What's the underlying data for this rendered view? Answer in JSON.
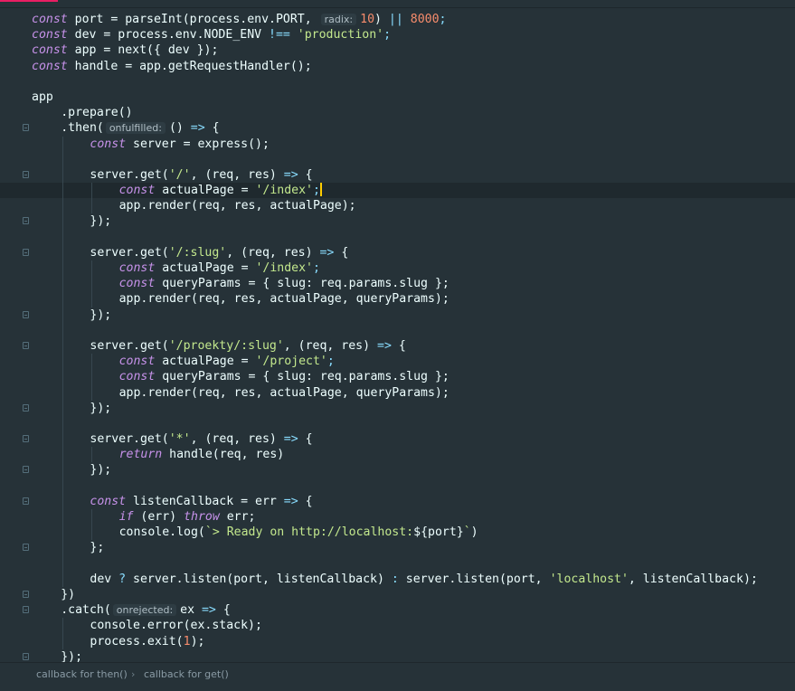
{
  "editor": {
    "lines": [
      {
        "fold": false,
        "indent": 0,
        "tokens": [
          [
            "kw",
            "const"
          ],
          [
            "fn",
            " port = parseInt(process.env.PORT, "
          ],
          [
            "hint",
            "radix:"
          ],
          [
            "num",
            "10"
          ],
          [
            "fn",
            ") "
          ],
          [
            "op",
            "||"
          ],
          [
            "fn",
            " "
          ],
          [
            "num",
            "8000"
          ],
          [
            "pun",
            ";"
          ]
        ]
      },
      {
        "fold": false,
        "indent": 0,
        "tokens": [
          [
            "kw",
            "const"
          ],
          [
            "fn",
            " dev = process.env.NODE_ENV "
          ],
          [
            "op",
            "!=="
          ],
          [
            "fn",
            " "
          ],
          [
            "str",
            "'production'"
          ],
          [
            "pun",
            ";"
          ]
        ]
      },
      {
        "fold": false,
        "indent": 0,
        "tokens": [
          [
            "kw",
            "const"
          ],
          [
            "fn",
            " app = next({ dev });"
          ]
        ]
      },
      {
        "fold": false,
        "indent": 0,
        "tokens": [
          [
            "kw",
            "const"
          ],
          [
            "fn",
            " handle = app.getRequestHandler();"
          ]
        ]
      },
      {
        "fold": false,
        "indent": 0,
        "tokens": []
      },
      {
        "fold": false,
        "indent": 0,
        "tokens": [
          [
            "fn",
            "app"
          ]
        ]
      },
      {
        "fold": false,
        "indent": 1,
        "tokens": [
          [
            "fn",
            ".prepare()"
          ]
        ]
      },
      {
        "fold": true,
        "indent": 1,
        "tokens": [
          [
            "fn",
            ".then("
          ],
          [
            "hint",
            "onfulfilled:"
          ],
          [
            "fn",
            "() "
          ],
          [
            "op",
            "=>"
          ],
          [
            "fn",
            " {"
          ]
        ]
      },
      {
        "fold": false,
        "indent": 2,
        "tokens": [
          [
            "kw",
            "const"
          ],
          [
            "fn",
            " server = express();"
          ]
        ]
      },
      {
        "fold": false,
        "indent": 2,
        "tokens": []
      },
      {
        "fold": true,
        "indent": 2,
        "tokens": [
          [
            "fn",
            "server.get("
          ],
          [
            "str",
            "'/'"
          ],
          [
            "fn",
            ", (req, res) "
          ],
          [
            "op",
            "=>"
          ],
          [
            "fn",
            " {"
          ]
        ]
      },
      {
        "fold": false,
        "indent": 3,
        "active": true,
        "tokens": [
          [
            "kw",
            "const"
          ],
          [
            "fn",
            " actualPage = "
          ],
          [
            "str",
            "'/index'"
          ],
          [
            "pun",
            ";"
          ],
          [
            "caret",
            ""
          ]
        ]
      },
      {
        "fold": false,
        "indent": 3,
        "tokens": [
          [
            "fn",
            "app.render(req, res, actualPage);"
          ]
        ]
      },
      {
        "fold": true,
        "indent": 2,
        "tokens": [
          [
            "fn",
            "});"
          ]
        ]
      },
      {
        "fold": false,
        "indent": 2,
        "tokens": []
      },
      {
        "fold": true,
        "indent": 2,
        "tokens": [
          [
            "fn",
            "server.get("
          ],
          [
            "str",
            "'/:slug'"
          ],
          [
            "fn",
            ", (req, res) "
          ],
          [
            "op",
            "=>"
          ],
          [
            "fn",
            " {"
          ]
        ]
      },
      {
        "fold": false,
        "indent": 3,
        "tokens": [
          [
            "kw",
            "const"
          ],
          [
            "fn",
            " actualPage = "
          ],
          [
            "str",
            "'/index'"
          ],
          [
            "pun",
            ";"
          ]
        ]
      },
      {
        "fold": false,
        "indent": 3,
        "tokens": [
          [
            "kw",
            "const"
          ],
          [
            "fn",
            " queryParams = { slug: req.params.slug };"
          ]
        ]
      },
      {
        "fold": false,
        "indent": 3,
        "tokens": [
          [
            "fn",
            "app.render(req, res, actualPage, queryParams);"
          ]
        ]
      },
      {
        "fold": true,
        "indent": 2,
        "tokens": [
          [
            "fn",
            "});"
          ]
        ]
      },
      {
        "fold": false,
        "indent": 2,
        "tokens": []
      },
      {
        "fold": true,
        "indent": 2,
        "tokens": [
          [
            "fn",
            "server.get("
          ],
          [
            "str",
            "'/proekty/:slug'"
          ],
          [
            "fn",
            ", (req, res) "
          ],
          [
            "op",
            "=>"
          ],
          [
            "fn",
            " {"
          ]
        ]
      },
      {
        "fold": false,
        "indent": 3,
        "tokens": [
          [
            "kw",
            "const"
          ],
          [
            "fn",
            " actualPage = "
          ],
          [
            "str",
            "'/project'"
          ],
          [
            "pun",
            ";"
          ]
        ]
      },
      {
        "fold": false,
        "indent": 3,
        "tokens": [
          [
            "kw",
            "const"
          ],
          [
            "fn",
            " queryParams = { slug: req.params.slug };"
          ]
        ]
      },
      {
        "fold": false,
        "indent": 3,
        "tokens": [
          [
            "fn",
            "app.render(req, res, actualPage, queryParams);"
          ]
        ]
      },
      {
        "fold": true,
        "indent": 2,
        "tokens": [
          [
            "fn",
            "});"
          ]
        ]
      },
      {
        "fold": false,
        "indent": 2,
        "tokens": []
      },
      {
        "fold": true,
        "indent": 2,
        "tokens": [
          [
            "fn",
            "server.get("
          ],
          [
            "str",
            "'*'"
          ],
          [
            "fn",
            ", (req, res) "
          ],
          [
            "op",
            "=>"
          ],
          [
            "fn",
            " {"
          ]
        ]
      },
      {
        "fold": false,
        "indent": 3,
        "tokens": [
          [
            "kw",
            "return"
          ],
          [
            "fn",
            " handle(req, res)"
          ]
        ]
      },
      {
        "fold": true,
        "indent": 2,
        "tokens": [
          [
            "fn",
            "});"
          ]
        ]
      },
      {
        "fold": false,
        "indent": 2,
        "tokens": []
      },
      {
        "fold": true,
        "indent": 2,
        "tokens": [
          [
            "kw",
            "const"
          ],
          [
            "fn",
            " listenCallback = err "
          ],
          [
            "op",
            "=>"
          ],
          [
            "fn",
            " {"
          ]
        ]
      },
      {
        "fold": false,
        "indent": 3,
        "tokens": [
          [
            "kw",
            "if"
          ],
          [
            "fn",
            " (err) "
          ],
          [
            "kw",
            "throw"
          ],
          [
            "fn",
            " err;"
          ]
        ]
      },
      {
        "fold": false,
        "indent": 3,
        "tokens": [
          [
            "fn",
            "console.log("
          ],
          [
            "str",
            "`> Ready on http://localhost:"
          ],
          [
            "fn",
            "${port}"
          ],
          [
            "str",
            "`"
          ],
          [
            "fn",
            ")"
          ]
        ]
      },
      {
        "fold": true,
        "indent": 2,
        "tokens": [
          [
            "fn",
            "};"
          ]
        ]
      },
      {
        "fold": false,
        "indent": 2,
        "tokens": []
      },
      {
        "fold": false,
        "indent": 2,
        "tokens": [
          [
            "fn",
            "dev "
          ],
          [
            "op",
            "?"
          ],
          [
            "fn",
            " server.listen(port, listenCallback) "
          ],
          [
            "op",
            ":"
          ],
          [
            "fn",
            " server.listen(port, "
          ],
          [
            "str",
            "'localhost'"
          ],
          [
            "fn",
            ", listenCallback);"
          ]
        ]
      },
      {
        "fold": true,
        "indent": 1,
        "tokens": [
          [
            "fn",
            "})"
          ]
        ]
      },
      {
        "fold": true,
        "indent": 1,
        "tokens": [
          [
            "fn",
            ".catch("
          ],
          [
            "hint",
            "onrejected:"
          ],
          [
            "fn",
            "ex "
          ],
          [
            "op",
            "=>"
          ],
          [
            "fn",
            " {"
          ]
        ]
      },
      {
        "fold": false,
        "indent": 2,
        "tokens": [
          [
            "fn",
            "console.error(ex.stack);"
          ]
        ]
      },
      {
        "fold": false,
        "indent": 2,
        "tokens": [
          [
            "fn",
            "process.exit("
          ],
          [
            "num",
            "1"
          ],
          [
            "fn",
            ");"
          ]
        ]
      },
      {
        "fold": true,
        "indent": 1,
        "tokens": [
          [
            "fn",
            "});"
          ]
        ]
      }
    ]
  },
  "statusbar": {
    "crumbs": [
      "callback for then()",
      "callback for get()"
    ],
    "separator": "›"
  },
  "colors": {
    "background": "#263238",
    "keyword": "#c792ea",
    "string": "#c3e88d",
    "number": "#f78c6c",
    "operator": "#89ddff",
    "text": "#eeffff",
    "caret": "#ffcc00",
    "accent": "#e91e63"
  }
}
